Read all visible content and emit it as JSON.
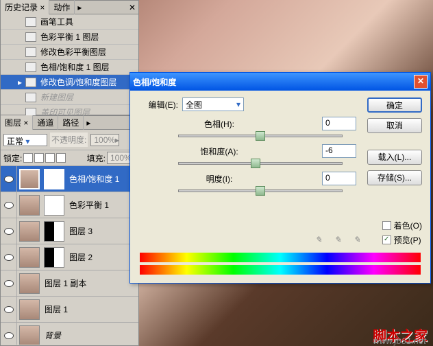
{
  "history": {
    "tabs": [
      "历史记录",
      "动作"
    ],
    "items": [
      {
        "label": "画笔工具",
        "sel": false,
        "dim": false
      },
      {
        "label": "色彩平衡 1 图层",
        "sel": false,
        "dim": false
      },
      {
        "label": "修改色彩平衡图层",
        "sel": false,
        "dim": false
      },
      {
        "label": "色相/饱和度 1 图层",
        "sel": false,
        "dim": false
      },
      {
        "label": "修改色调/饱和度图层",
        "sel": true,
        "dim": false
      },
      {
        "label": "新建图层",
        "sel": false,
        "dim": true
      },
      {
        "label": "盖印可见图层",
        "sel": false,
        "dim": true
      }
    ]
  },
  "layers": {
    "tabs": [
      "图层",
      "通道",
      "路径"
    ],
    "blend_label": "正常",
    "opacity_label": "不透明度:",
    "opacity_val": "100%",
    "lock_label": "锁定:",
    "fill_label": "填充:",
    "fill_val": "100%",
    "items": [
      {
        "name": "色相/饱和度 1",
        "sel": true,
        "thumbs": [
          "img",
          "mask"
        ]
      },
      {
        "name": "色彩平衡 1",
        "sel": false,
        "thumbs": [
          "img",
          "mask"
        ]
      },
      {
        "name": "图层 3",
        "sel": false,
        "thumbs": [
          "img",
          "bw"
        ]
      },
      {
        "name": "图层 2",
        "sel": false,
        "thumbs": [
          "img",
          "bw"
        ]
      },
      {
        "name": "图层 1 副本",
        "sel": false,
        "thumbs": [
          "img"
        ]
      },
      {
        "name": "图层 1",
        "sel": false,
        "thumbs": [
          "img"
        ]
      },
      {
        "name": "背景",
        "sel": false,
        "thumbs": [
          "img"
        ],
        "italic": true
      }
    ]
  },
  "dialog": {
    "title": "色相/饱和度",
    "edit_label": "编辑(E):",
    "edit_value": "全图",
    "sliders": [
      {
        "label": "色相(H):",
        "value": "0",
        "pos": 50
      },
      {
        "label": "饱和度(A):",
        "value": "-6",
        "pos": 47
      },
      {
        "label": "明度(I):",
        "value": "0",
        "pos": 50
      }
    ],
    "buttons": {
      "ok": "确定",
      "cancel": "取消",
      "load": "载入(L)...",
      "save": "存储(S)..."
    },
    "colorize": "着色(O)",
    "preview": "预览(P)"
  },
  "watermark": {
    "main": "脚本之家",
    "sub": "www.jb51.net"
  }
}
